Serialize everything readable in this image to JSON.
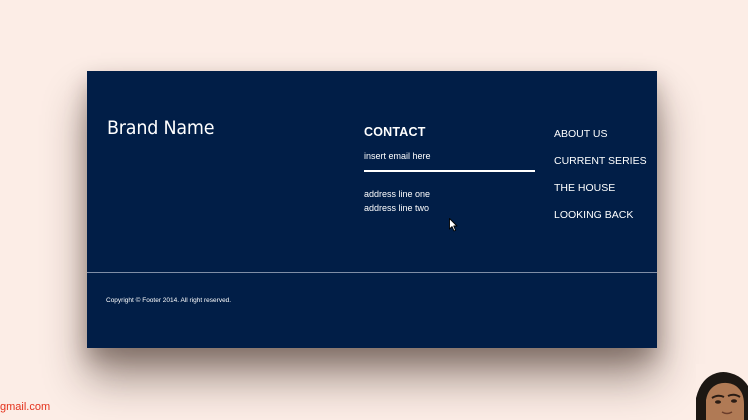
{
  "page": {
    "background": "#fcede6",
    "footer_bg": "#011e47"
  },
  "footer": {
    "brand": "Brand Name",
    "contact": {
      "title": "CONTACT",
      "email_placeholder": "insert email here",
      "address_line_1": "address line one",
      "address_line_2": "address line two"
    },
    "nav": [
      {
        "label": "ABOUT US"
      },
      {
        "label": "CURRENT SERIES"
      },
      {
        "label": "THE HOUSE"
      },
      {
        "label": "LOOKING BACK"
      }
    ],
    "copyright": "Copyright © Footer 2014. All right reserved."
  },
  "overlay": {
    "email_fragment": "gmail.com",
    "email_fragment_color": "#e4321c"
  }
}
